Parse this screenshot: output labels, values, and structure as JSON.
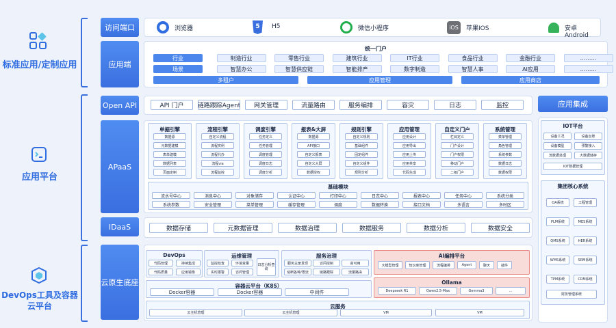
{
  "categories": {
    "standard": "标准应用/定制应用",
    "platform": "应用平台",
    "devops": "DevOps工具及容器云平台"
  },
  "access": {
    "label": "访问端口",
    "items": [
      {
        "name": "浏览器",
        "icon": "chrome-icon"
      },
      {
        "name": "H5",
        "icon": "html5-icon"
      },
      {
        "name": "微信小程序",
        "icon": "wechat-miniprogram-icon"
      },
      {
        "name": "苹果IOS",
        "icon": "ios-icon"
      },
      {
        "name": "安卓Android",
        "icon": "android-icon"
      }
    ]
  },
  "app": {
    "label": "应用端",
    "portal": "统一门户",
    "row1": [
      "行业",
      "制造行业",
      "零售行业",
      "建筑行业",
      "IT行业",
      "食品行业",
      "金融行业",
      "………"
    ],
    "row2": [
      "场景",
      "智慧办公",
      "智慧供应链",
      "智能排产",
      "数字制造",
      "智慧人事",
      "AI应用",
      "………"
    ],
    "row3": [
      "多租户",
      "应用管理",
      "应用商店"
    ]
  },
  "openapi": {
    "label": "Open API",
    "items": [
      "API 门户",
      "链路跟踪Agent",
      "网关管理",
      "流量路由",
      "服务编排",
      "容灾",
      "日志",
      "监控"
    ]
  },
  "integration": {
    "title": "应用集成"
  },
  "apaas": {
    "label": "APaaS",
    "engines": [
      {
        "title": "单据引擎",
        "items": [
          "数据源",
          "元数据建模",
          "表单建模",
          "数据列表",
          "页面定制"
        ]
      },
      {
        "title": "流程引擎",
        "items": [
          "自定义流程",
          "流程实例",
          "流程代办",
          "流程via",
          "流程监控"
        ]
      },
      {
        "title": "调度引擎",
        "items": [
          "任务定义",
          "任务管理",
          "调度管理",
          "调度日志",
          "调度分析"
        ]
      },
      {
        "title": "报表&大屏",
        "items": [
          "数据源",
          "API接口",
          "自定义报表",
          "自定义大屏",
          "数据授权"
        ]
      },
      {
        "title": "规则引擎",
        "items": [
          "自定义规则",
          "基础组件",
          "固定组件",
          "自定义组件",
          "规则分析"
        ]
      },
      {
        "title": "应用管理",
        "items": [
          "应用设计",
          "应用导出",
          "应用上传",
          "应用共享",
          "代码生成"
        ]
      },
      {
        "title": "自定义门户",
        "items": [
          "栏目定义",
          "门户设计",
          "门户权限",
          "移动门户",
          "二级门户"
        ]
      },
      {
        "title": "系统管理",
        "items": [
          "菜单管理",
          "角色管理",
          "系统参数",
          "数据日志",
          "数据权限"
        ]
      }
    ],
    "basic": {
      "title": "基础模块",
      "row1": [
        "流水号中心",
        "消息中心",
        "对象储存",
        "认证中心",
        "打印中心",
        "日志中心",
        "报表中心",
        "任务中心",
        "系统分类"
      ],
      "row2": [
        "系统参数",
        "安全管理",
        "菜单管理",
        "缓存管理",
        "调度",
        "数据转换",
        "接口文档",
        "多语言",
        "多时区"
      ]
    }
  },
  "iot": {
    "title": "IOT平台",
    "items": [
      "设备工况",
      "设备台账",
      "设备模型",
      "预警接入",
      "流数据处理",
      "大数据储存",
      "IOT数据管理"
    ]
  },
  "core": {
    "title": "集团核心系统",
    "items": [
      "OA系统",
      "工程管理",
      "PLM系统",
      "MES系统",
      "QMS系统",
      "HER系统",
      "WMS系统",
      "SRM系统",
      "TPM系统",
      "CRM系统",
      "财务管理系统"
    ]
  },
  "idaas": {
    "label": "IDaaS",
    "items": [
      "数据存储",
      "元数据管理",
      "数据治理",
      "数据服务",
      "数据分析",
      "数据安全"
    ]
  },
  "cloud": {
    "label": "云原生底座",
    "devops": {
      "title": "DevOps",
      "items": [
        "代码管理",
        "持续集成",
        "代码质量",
        "应用镜像"
      ]
    },
    "ops": {
      "title": "运维管理",
      "items": [
        "监控检查",
        "环境变量",
        "实时报警",
        "访问管理",
        "日志分析查询"
      ]
    },
    "svc": {
      "title": "服务治理",
      "items": [
        "服务主册发现",
        "访问控制",
        "高可用",
        "熔断各种/限流",
        "链路跟踪",
        "流量路由"
      ]
    },
    "ai": {
      "title": "AI编排平台",
      "items": [
        "大模型管理",
        "知识库管理",
        "流程编排",
        "Agent",
        "聊天",
        "插件"
      ]
    },
    "k8s": {
      "title": "容器云平台（K8S）",
      "items": [
        "Docker容器",
        "Docker容器",
        "中间件"
      ]
    },
    "ollama": {
      "title": "Ollama",
      "items": [
        "Deepseek R1",
        "Qwen2.5-Max",
        "Gemma3",
        "..."
      ]
    },
    "cs": {
      "title": "云服务",
      "items": [
        "云主机管理",
        "云主机管理",
        "VM",
        "VM"
      ]
    }
  },
  "colors": {
    "accent": "#3a6fe0",
    "ai": "#e88a86"
  }
}
